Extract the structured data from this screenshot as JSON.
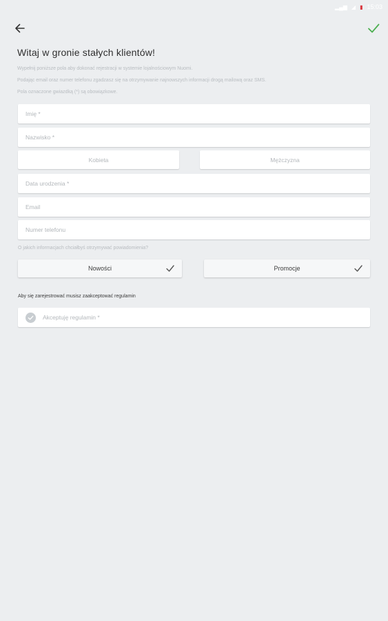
{
  "status_bar": {
    "icons": [
      "wifi-icon",
      "signal-icon",
      "battery-icon"
    ],
    "time": "15:03"
  },
  "header": {
    "back_icon": "arrow-left-icon",
    "confirm_icon": "check-icon",
    "confirm_color": "#4caf50"
  },
  "title": "Witaj w gronie stałych klientów!",
  "info_lines": [
    "Wypełnij poniższe pola aby dokonać rejestracji w systemie lojalnościowym Nuomi.",
    "Podając email oraz numer telefonu zgadzasz się na otrzymywanie najnowszych informacji drogą mailową oraz SMS.",
    "Pola oznaczone gwiazdką (*) są obowiązkowe."
  ],
  "fields": {
    "first_name": "Imię *",
    "last_name": "Nazwisko *",
    "birth_date": "Data urodzenia *",
    "email": "Email",
    "phone": "Numer telefonu"
  },
  "gender": {
    "female": "Kobieta",
    "male": "Mężczyzna"
  },
  "notifications": {
    "question": "O jakich informacjach chciałbyś otrzymywać powiadomienia?",
    "news_label": "Nowości",
    "news_checked": true,
    "promo_label": "Promocje",
    "promo_checked": true
  },
  "terms": {
    "label": "Aby się zarejestrować musisz zaakceptować regulamin",
    "checkbox_label": "Akceptuję regulamin *"
  }
}
